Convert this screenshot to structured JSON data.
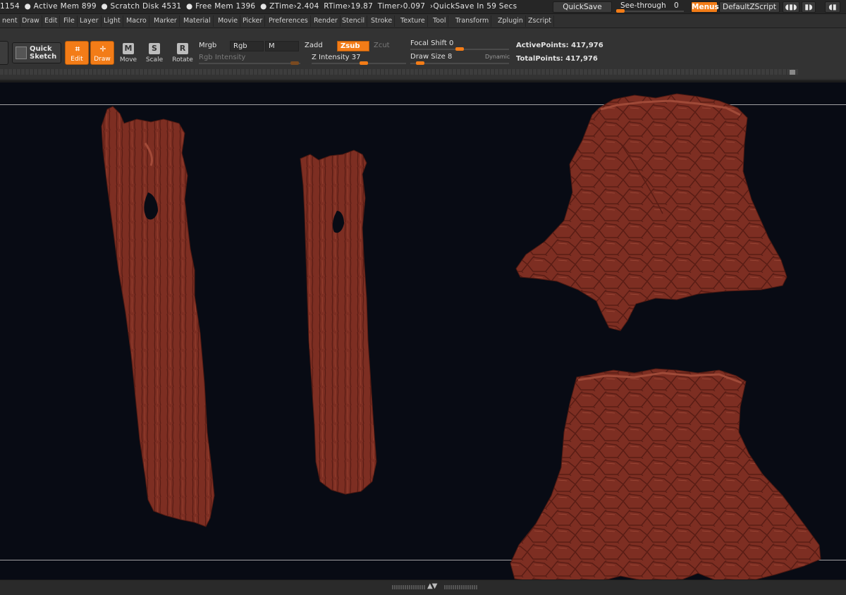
{
  "status": {
    "items": [
      "1154",
      "● Active Mem 899",
      "● Scratch Disk 4531",
      "● Free Mem 1396",
      "● ZTime›2.404",
      "RTime›19.87",
      "Timer›0.097",
      "›QuickSave In 59 Secs"
    ],
    "quicksave_label": "QuickSave",
    "see_through_label": "See-through",
    "see_through_value": "0",
    "menus_label": "Menus",
    "default_zscript_label": "DefaultZScript",
    "accent_color": "#f37c17"
  },
  "menubar": {
    "items": [
      "nent",
      "Draw",
      "Edit",
      "File",
      "Layer",
      "Light",
      "Macro",
      "Marker",
      "Material",
      "Movie",
      "Picker",
      "Preferences",
      "Render",
      "Stencil",
      "Stroke",
      "Texture",
      "Tool",
      "Transform",
      "Zplugin",
      "Zscript"
    ]
  },
  "shelf": {
    "quick_sketch_line1": "Quick",
    "quick_sketch_line2": "Sketch",
    "modes": [
      {
        "label": "Edit",
        "glyph": "⌗",
        "active": true
      },
      {
        "label": "Draw",
        "glyph": "✛",
        "active": true
      },
      {
        "label": "Move",
        "glyph": "M",
        "active": false
      },
      {
        "label": "Scale",
        "glyph": "S",
        "active": false
      },
      {
        "label": "Rotate",
        "glyph": "R",
        "active": false
      }
    ],
    "mrgb": "Mrgb",
    "rgb": "Rgb",
    "m": "M",
    "rgb_intensity_label": "Rgb Intensity",
    "zadd": "Zadd",
    "zsub": "Zsub",
    "zcut": "Zcut",
    "z_intensity_label": "Z Intensity",
    "z_intensity_value": "37",
    "focal_shift_label": "Focal Shift",
    "focal_shift_value": "0",
    "draw_size_label": "Draw Size",
    "draw_size_value": "8",
    "dynamic_label": "Dynamic",
    "active_points_label": "ActivePoints:",
    "active_points_value": "417,976",
    "total_points_label": "TotalPoints:",
    "total_points_value": "417,976"
  },
  "viewport": {
    "mesh_color": "#7d2e22",
    "background_color": "#080b14"
  }
}
